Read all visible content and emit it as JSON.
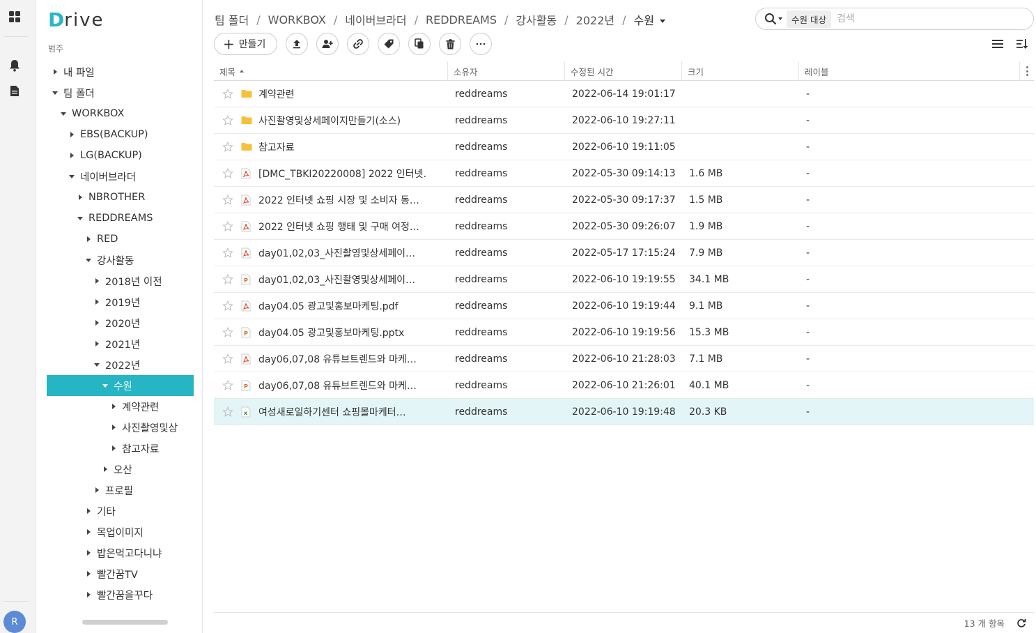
{
  "app": {
    "logo_initial": "D",
    "logo_rest": "rive"
  },
  "rail": {
    "avatar_initial": "R"
  },
  "sidebar": {
    "section_label": "범주",
    "tree": [
      {
        "label": "내 파일",
        "level": 0,
        "state": "collapsed"
      },
      {
        "label": "팀 폴더",
        "level": 0,
        "state": "expanded"
      },
      {
        "label": "WORKBOX",
        "level": 1,
        "state": "expanded"
      },
      {
        "label": "EBS(BACKUP)",
        "level": 2,
        "state": "collapsed"
      },
      {
        "label": "LG(BACKUP)",
        "level": 2,
        "state": "collapsed"
      },
      {
        "label": "네이버브라더",
        "level": 2,
        "state": "expanded"
      },
      {
        "label": "NBROTHER",
        "level": 3,
        "state": "collapsed"
      },
      {
        "label": "REDDREAMS",
        "level": 3,
        "state": "expanded"
      },
      {
        "label": "RED",
        "level": 4,
        "state": "collapsed"
      },
      {
        "label": "강사활동",
        "level": 4,
        "state": "expanded"
      },
      {
        "label": "2018년 이전",
        "level": 5,
        "state": "collapsed"
      },
      {
        "label": "2019년",
        "level": 5,
        "state": "collapsed"
      },
      {
        "label": "2020년",
        "level": 5,
        "state": "collapsed"
      },
      {
        "label": "2021년",
        "level": 5,
        "state": "collapsed"
      },
      {
        "label": "2022년",
        "level": 5,
        "state": "expanded"
      },
      {
        "label": "수원",
        "level": 6,
        "state": "expanded",
        "selected": true
      },
      {
        "label": "계약관련",
        "level": 7,
        "state": "collapsed"
      },
      {
        "label": "사진촬영및상",
        "level": 7,
        "state": "collapsed"
      },
      {
        "label": "참고자료",
        "level": 7,
        "state": "collapsed"
      },
      {
        "label": "오산",
        "level": 6,
        "state": "collapsed"
      },
      {
        "label": "프로필",
        "level": 5,
        "state": "collapsed"
      },
      {
        "label": "기타",
        "level": 4,
        "state": "collapsed"
      },
      {
        "label": "목업이미지",
        "level": 4,
        "state": "collapsed"
      },
      {
        "label": "밥은먹고다니냐",
        "level": 4,
        "state": "collapsed"
      },
      {
        "label": "빨간꿈TV",
        "level": 4,
        "state": "collapsed"
      },
      {
        "label": "빨간꿈을꾸다",
        "level": 4,
        "state": "collapsed"
      }
    ]
  },
  "breadcrumb": {
    "items": [
      "팀 폴더",
      "WORKBOX",
      "네이버브라더",
      "REDDREAMS",
      "강사활동",
      "2022년"
    ],
    "current": "수원",
    "separator": "/"
  },
  "search": {
    "scope": "수원 대상",
    "placeholder": "검색"
  },
  "toolbar": {
    "create_label": "만들기"
  },
  "table": {
    "columns": {
      "name": "제목",
      "owner": "소유자",
      "modified": "수정된 시간",
      "size": "크기",
      "label": "레이블"
    },
    "rows": [
      {
        "type": "folder",
        "name": "계약관련",
        "owner": "reddreams",
        "modified": "2022-06-14 19:01:17",
        "size": "",
        "label": "-"
      },
      {
        "type": "folder",
        "name": "사진촬영및상세페이지만들기(소스)",
        "owner": "reddreams",
        "modified": "2022-06-10 19:27:11",
        "size": "",
        "label": "-"
      },
      {
        "type": "folder",
        "name": "참고자료",
        "owner": "reddreams",
        "modified": "2022-06-10 19:11:05",
        "size": "",
        "label": "-"
      },
      {
        "type": "pdf",
        "name": "[DMC_TBKI20220008] 2022 인터넷…",
        "owner": "reddreams",
        "modified": "2022-05-30 09:14:13",
        "size": "1.6 MB",
        "label": "-"
      },
      {
        "type": "pdf",
        "name": "2022 인터넷 쇼핑 시장 및 소비자 동…",
        "owner": "reddreams",
        "modified": "2022-05-30 09:17:37",
        "size": "1.5 MB",
        "label": "-"
      },
      {
        "type": "pdf",
        "name": "2022 인터넷 쇼핑 행태 및 구매 여정…",
        "owner": "reddreams",
        "modified": "2022-05-30 09:26:07",
        "size": "1.9 MB",
        "label": "-"
      },
      {
        "type": "pdf",
        "name": "day01,02,03_사진촬영및상세페이…",
        "owner": "reddreams",
        "modified": "2022-05-17 17:15:24",
        "size": "7.9 MB",
        "label": "-"
      },
      {
        "type": "ppt",
        "name": "day01,02,03_사진촬영및상세페이…",
        "owner": "reddreams",
        "modified": "2022-06-10 19:19:55",
        "size": "34.1 MB",
        "label": "-"
      },
      {
        "type": "pdf",
        "name": "day04.05 광고및홍보마케팅.pdf",
        "owner": "reddreams",
        "modified": "2022-06-10 19:19:44",
        "size": "9.1 MB",
        "label": "-"
      },
      {
        "type": "ppt",
        "name": "day04.05 광고및홍보마케팅.pptx",
        "owner": "reddreams",
        "modified": "2022-06-10 19:19:56",
        "size": "15.3 MB",
        "label": "-"
      },
      {
        "type": "pdf",
        "name": "day06,07,08 유튜브트렌드와 마케…",
        "owner": "reddreams",
        "modified": "2022-06-10 21:28:03",
        "size": "7.1 MB",
        "label": "-"
      },
      {
        "type": "ppt",
        "name": "day06,07,08 유튜브트렌드와 마케…",
        "owner": "reddreams",
        "modified": "2022-06-10 21:26:01",
        "size": "40.1 MB",
        "label": "-"
      },
      {
        "type": "xls",
        "name": "여성새로일하기센터 쇼핑몰마케터…",
        "owner": "reddreams",
        "modified": "2022-06-10 19:19:48",
        "size": "20.3 KB",
        "label": "-",
        "selected": true
      }
    ]
  },
  "footer": {
    "count": "13 개 항목"
  },
  "colors": {
    "accent": "#25b5c5",
    "selected_row": "#e3f5f7",
    "folder": "#f5c13b",
    "pdf": "#d9472b",
    "ppt": "#d9692b",
    "xls": "#2e8b3d"
  }
}
